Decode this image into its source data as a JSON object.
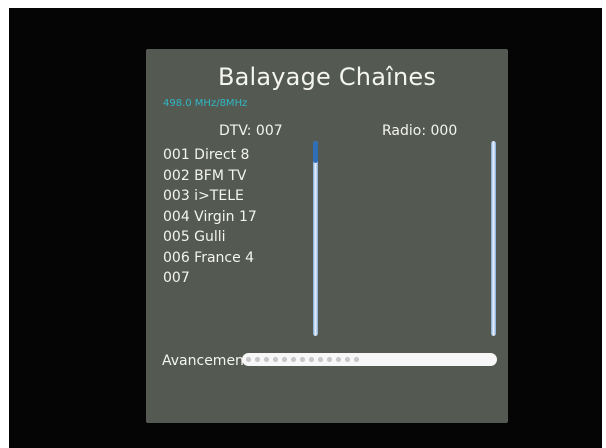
{
  "screen": {
    "title": "Balayage Chaînes",
    "frequency": "498.0 MHz/8MHz",
    "dtv_label": "DTV: 007",
    "radio_label": "Radio: 000",
    "channels": [
      "001 Direct 8",
      "002 BFM TV",
      "003 i>TELE",
      "004 Virgin 17",
      "005 Gulli",
      "006 France 4",
      "007"
    ],
    "progress_label": "Avancement",
    "progress_fraction": 0.47
  },
  "colors": {
    "panel_background": "#545952",
    "frequency_text": "#2fb8c4",
    "scrollbar": "#7fa6d4",
    "progress_track": "#f7f7f7"
  }
}
